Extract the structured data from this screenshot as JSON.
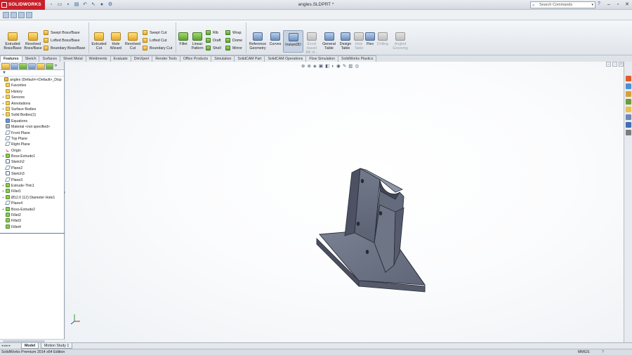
{
  "app": {
    "brand": "SOLIDWORKS",
    "document_title": "angles.SLDPRT *"
  },
  "search": {
    "placeholder": "Search Commands"
  },
  "icons": {
    "qat": [
      "new-icon",
      "open-icon",
      "save-icon",
      "print-icon",
      "undo-icon",
      "select-icon",
      "rebuild-icon",
      "options-icon"
    ],
    "window": [
      "help-icon",
      "minimize-icon",
      "restore-icon",
      "close-icon"
    ]
  },
  "command_manager": {
    "extruded_boss": "Extruded\nBoss/Base",
    "revolved_boss": "Revolved\nBoss/Base",
    "swept_boss": "Swept Boss/Base",
    "lofted_boss": "Lofted Boss/Base",
    "boundary_boss": "Boundary Boss/Base",
    "extruded_cut": "Extruded\nCut",
    "hole_wizard": "Hole\nWizard",
    "revolved_cut": "Revolved\nCut",
    "swept_cut": "Swept Cut",
    "lofted_cut": "Lofted Cut",
    "boundary_cut": "Boundary Cut",
    "fillet": "Fillet",
    "linear_pattern": "Linear\nPattern",
    "rib": "Rib",
    "draft": "Draft",
    "shell": "Shell",
    "wrap": "Wrap",
    "dome": "Dome",
    "mirror": "Mirror",
    "reference_geometry": "Reference\nGeometry",
    "curves": "Curves",
    "instant3d": "Instant3D",
    "excel_bom": "Excel\nbased\nBill of...",
    "general_table": "General\nTable",
    "design_table": "Design\nTable",
    "hole_table": "Hole\nTable",
    "flex": "Flex",
    "drilling": "Drilling",
    "angled_grooving": "Angled\nGrooving"
  },
  "tabs": [
    "Features",
    "Sketch",
    "Surfaces",
    "Sheet Metal",
    "Weldments",
    "Evaluate",
    "DimXpert",
    "Render Tools",
    "Office Products",
    "Simulation",
    "SolidCAM Part",
    "SolidCAM Operations",
    "Flow Simulation",
    "SolidWorks Plastics"
  ],
  "active_tab": "Features",
  "feature_tree": [
    {
      "label": "angles  (Default<<Default>_Disp",
      "icon": "part-icon"
    },
    {
      "label": "Favorites",
      "icon": "folder-icon"
    },
    {
      "label": "History",
      "icon": "folder-icon"
    },
    {
      "label": "Sensors",
      "icon": "folder-icon"
    },
    {
      "label": "Annotations",
      "icon": "folder-icon"
    },
    {
      "label": "Surface Bodies",
      "icon": "folder-icon"
    },
    {
      "label": "Solid Bodies(1)",
      "icon": "folder-icon"
    },
    {
      "label": "Equations",
      "icon": "equation-icon"
    },
    {
      "label": "Material <not specified>",
      "icon": "material-icon"
    },
    {
      "label": "Front Plane",
      "icon": "plane-icon"
    },
    {
      "label": "Top Plane",
      "icon": "plane-icon"
    },
    {
      "label": "Right Plane",
      "icon": "plane-icon"
    },
    {
      "label": "Origin",
      "icon": "origin-icon"
    },
    {
      "label": "Boss-Extrude1",
      "icon": "feature-icon"
    },
    {
      "label": "Sketch2",
      "icon": "sketch-icon"
    },
    {
      "label": "Plane2",
      "icon": "plane-icon"
    },
    {
      "label": "Sketch3",
      "icon": "sketch-icon"
    },
    {
      "label": "Plane3",
      "icon": "plane-icon"
    },
    {
      "label": "Extrude-Thin1",
      "icon": "feature-icon"
    },
    {
      "label": "Fillet1",
      "icon": "feature-icon"
    },
    {
      "label": "Ø12.0 (12) Diameter Hole1",
      "icon": "feature-icon"
    },
    {
      "label": "Plane4",
      "icon": "plane-icon"
    },
    {
      "label": "Boss-Extrude2",
      "icon": "feature-icon"
    },
    {
      "label": "Fillet2",
      "icon": "feature-icon"
    },
    {
      "label": "Fillet3",
      "icon": "feature-icon"
    },
    {
      "label": "Fillet4",
      "icon": "feature-icon"
    }
  ],
  "model_tabs": [
    "Model",
    "Motion Study 1"
  ],
  "status": {
    "edition": "SolidWorks Premium 2014 x64 Edition",
    "units": "MMGS",
    "help": "?"
  },
  "colors": {
    "brand_red": "#c8202a",
    "model_gray": "#6b7282",
    "selection_blue": "#4a7dc2"
  }
}
